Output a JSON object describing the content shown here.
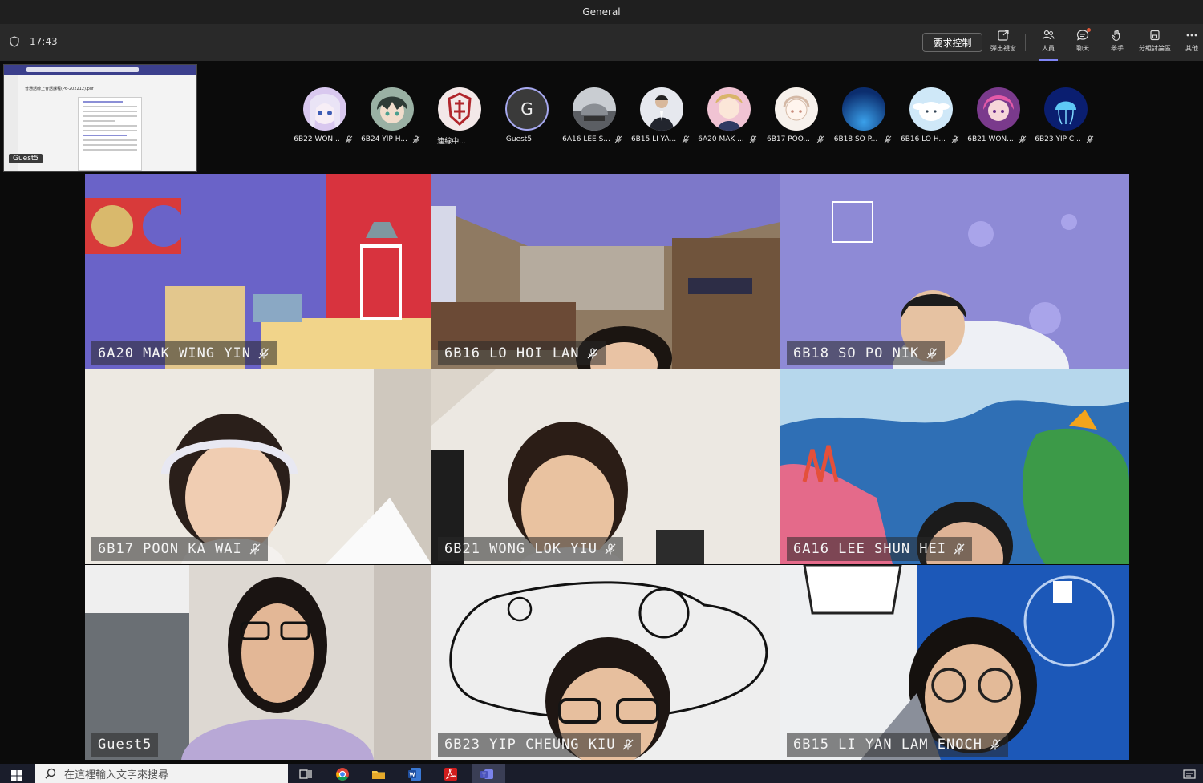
{
  "window": {
    "title": "General"
  },
  "meeting": {
    "time": "17:43",
    "request_control_label": "要求控制",
    "tools": [
      {
        "label": "彈出視窗",
        "icon": "popout-icon"
      },
      {
        "label": "人員",
        "icon": "people-icon"
      },
      {
        "label": "聊天",
        "icon": "chat-icon"
      },
      {
        "label": "舉手",
        "icon": "raise-hand-icon"
      },
      {
        "label": "分組討論區",
        "icon": "breakout-rooms-icon"
      },
      {
        "label": "其他",
        "icon": "more-icon"
      }
    ]
  },
  "shared_screen": {
    "presenter": "Guest5",
    "doc_title": "普通話線上會話課程(P6-202212).pdf"
  },
  "participants_strip": [
    {
      "name": "6B22 WON...",
      "avatar": "anime-girl-icon",
      "color": "#d9c8ef"
    },
    {
      "name": "6B24 YIP H...",
      "avatar": "anime-boy-icon",
      "color": "#4a5a48"
    },
    {
      "name": "連線中...",
      "avatar": "crest-icon",
      "color": "#f1e4e4"
    },
    {
      "name": "Guest5",
      "avatar": "initial-avatar",
      "initial": "G"
    },
    {
      "name": "6A16 LEE S...",
      "avatar": "car-seat-icon",
      "color": "#5b5e63"
    },
    {
      "name": "6B15 LI YA...",
      "avatar": "suit-figure-icon",
      "color": "#c9ccd4"
    },
    {
      "name": "6A20 MAK ...",
      "avatar": "anime-character-icon",
      "color": "#e8b6c8"
    },
    {
      "name": "6B17 POO...",
      "avatar": "sketch-girl-icon",
      "color": "#f5efe9"
    },
    {
      "name": "6B18 SO P...",
      "avatar": "blue-gradient-icon",
      "color": "#1f6fc7"
    },
    {
      "name": "6B16 LO H...",
      "avatar": "cinnamoroll-icon",
      "color": "#bfe0f5"
    },
    {
      "name": "6B21 WON...",
      "avatar": "pink-anime-icon",
      "color": "#b24fa0"
    },
    {
      "name": "6B23 YIP C...",
      "avatar": "jellyfish-icon",
      "color": "#0c2c8a"
    }
  ],
  "video_tiles": [
    {
      "name": "6A20 MAK WING YIN"
    },
    {
      "name": "6B16 LO HOI LAN"
    },
    {
      "name": "6B18 SO PO NIK"
    },
    {
      "name": "6B17 POON KA WAI"
    },
    {
      "name": "6B21 WONG LOK YIU"
    },
    {
      "name": "6A16 LEE SHUN HEI"
    },
    {
      "name": "Guest5"
    },
    {
      "name": "6B23 YIP CHEUNG KIU"
    },
    {
      "name": "6B15 LI YAN LAM ENOCH"
    }
  ],
  "taskbar": {
    "search_placeholder": "在這裡輸入文字來搜尋"
  }
}
